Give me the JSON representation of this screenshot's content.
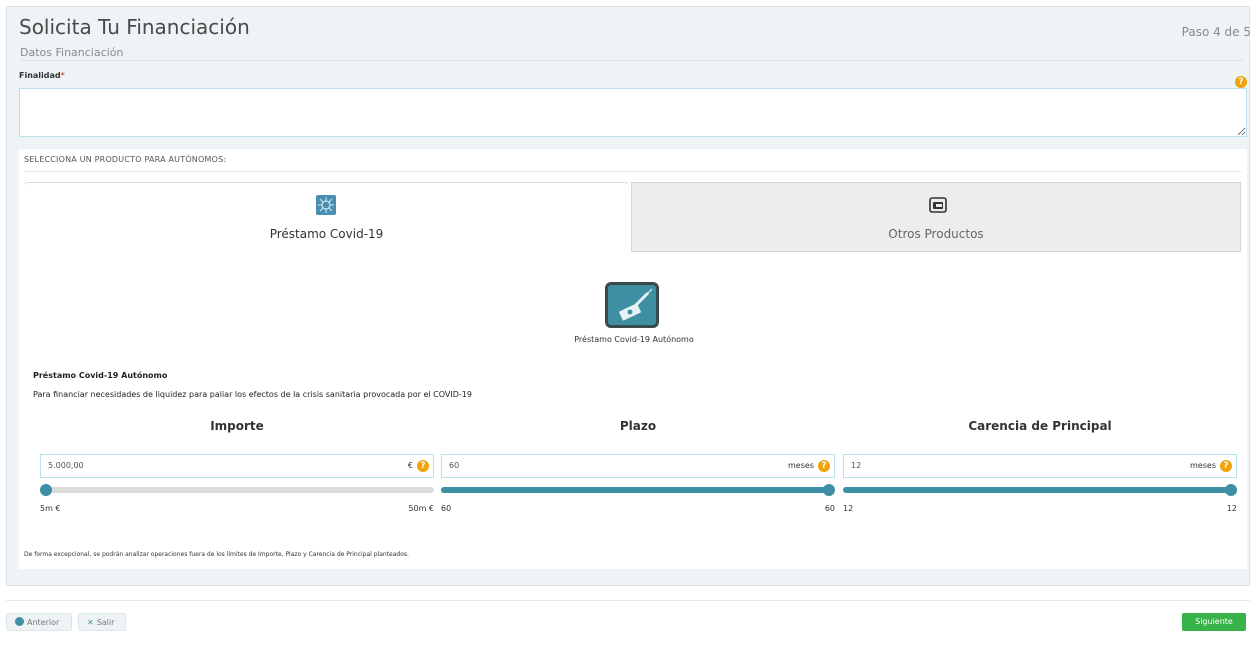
{
  "header": {
    "title": "Solicita Tu Financiación",
    "subtitle": "Datos Financiación",
    "step": "Paso 4 de 5"
  },
  "finalidad": {
    "label": "Finalidad",
    "required_mark": "*",
    "value": "",
    "help": "?"
  },
  "products": {
    "section_label": "SELECCIONA UN PRODUCTO PARA AUTÓNOMOS:",
    "tabs": [
      {
        "label": "Préstamo Covid-19",
        "icon": "virus-icon",
        "active": true
      },
      {
        "label": "Otros Productos",
        "icon": "wallet-icon",
        "active": false
      }
    ],
    "selected_product": {
      "label": "Préstamo Covid-19 Autónomo",
      "icon": "money-syringe-icon"
    },
    "description_title": "Préstamo Covid-19 Autónomo",
    "description_text": "Para financiar necesidades de liquidez para paliar los efectos de la crisis sanitaria provocada por el COVID-19"
  },
  "sliders": [
    {
      "title": "Importe",
      "value": "5.000,00",
      "unit": "€",
      "min": "5m €",
      "max": "50m €",
      "fraction": 0.0
    },
    {
      "title": "Plazo",
      "value": "60",
      "unit": "meses",
      "min": "60",
      "max": "60",
      "fraction": 1.0
    },
    {
      "title": "Carencia de Principal",
      "value": "12",
      "unit": "meses",
      "min": "12",
      "max": "12",
      "fraction": 1.0
    }
  ],
  "footnote": "De forma excepcional, se podrán analizar operaciones fuera de los límites de Importe, Plazo y Carencia de Principal planteados.",
  "nav": {
    "prev_label": "Anterior",
    "exit_label": "Salir",
    "next_label": "Siguiente"
  },
  "colors": {
    "accent": "#3e8fa5",
    "next_button": "#37b34a",
    "help": "#f0a30a",
    "required": "#d9534f"
  }
}
